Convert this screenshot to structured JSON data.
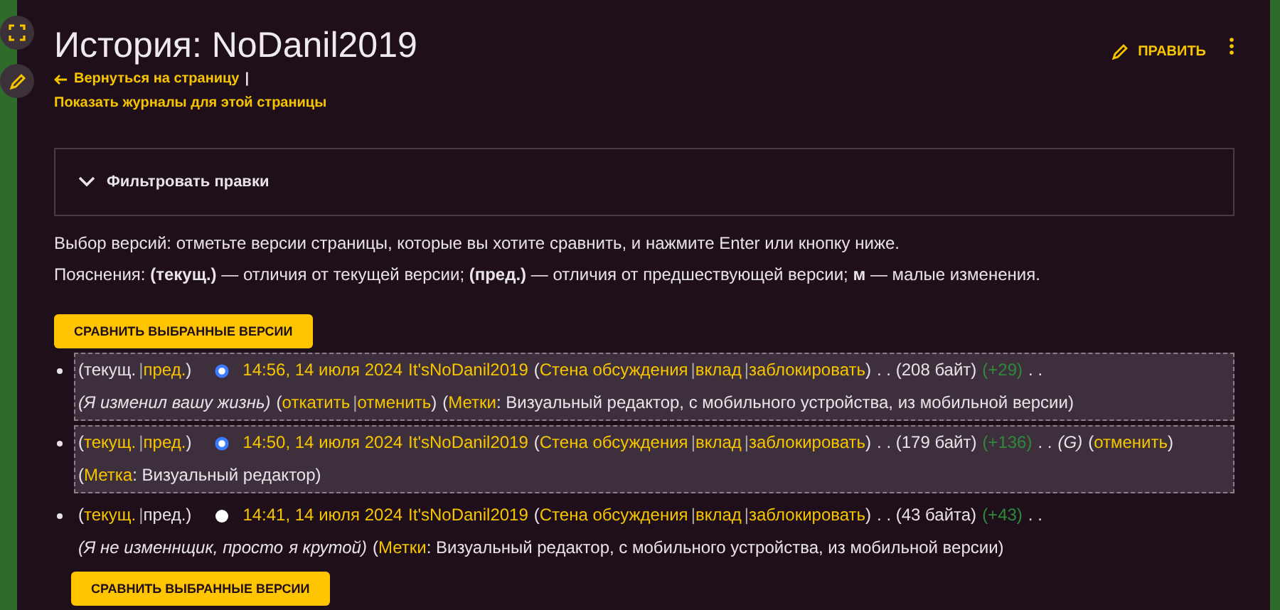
{
  "page": {
    "title": "История: NoDanil2019",
    "back_link": "Вернуться на страницу",
    "back_sep": "|",
    "logs_link": "Показать журналы для этой страницы",
    "edit_button": "ПРАВИТЬ"
  },
  "filter": {
    "label": "Фильтровать правки",
    "expanded": false
  },
  "intro": "Выбор версий: отметьте версии страницы, которые вы хотите сравнить, и нажмите Enter или кнопку ниже.",
  "legend": "Пояснения: **(текущ.)** — отличия от текущей версии; **(пред.)** — отличия от предшествующей версии; **м** — малые изменения.",
  "compare_buttons": [
    "СРАВНИТЬ ВЫБРАННЫЕ ВЕРСИИ",
    "СРАВНИТЬ ВЫБРАННЫЕ ВЕРСИИ"
  ],
  "revisions": [
    {
      "selected": true,
      "segments": [
        {
          "kind": "text",
          "text": "(текущ."
        },
        {
          "kind": "sep",
          "text": "|"
        },
        {
          "kind": "link",
          "text": "пред."
        },
        {
          "kind": "text",
          "text": ")"
        },
        {
          "kind": "radio",
          "checked": true
        },
        {
          "kind": "link",
          "text": "14:56, 14 июля 2024"
        },
        {
          "kind": "link",
          "text": "It'sNoDanil2019"
        },
        {
          "kind": "text",
          "text": "("
        },
        {
          "kind": "link",
          "text": "Стена обсуждения"
        },
        {
          "kind": "sep",
          "text": "|"
        },
        {
          "kind": "link",
          "text": "вклад"
        },
        {
          "kind": "sep",
          "text": "|"
        },
        {
          "kind": "link",
          "text": "заблокировать"
        },
        {
          "kind": "text",
          "text": ")"
        },
        {
          "kind": "text",
          "text": ". . (208 байт)"
        },
        {
          "kind": "diff",
          "text": "(+29)"
        },
        {
          "kind": "text",
          "text": ". ."
        },
        {
          "kind": "comment",
          "text": "(Я изменил вашу жизнь)"
        },
        {
          "kind": "text",
          "text": "("
        },
        {
          "kind": "link",
          "text": "откатить"
        },
        {
          "kind": "sep",
          "text": "|"
        },
        {
          "kind": "link",
          "text": "отменить"
        },
        {
          "kind": "text",
          "text": ")"
        },
        {
          "kind": "text",
          "text": "("
        },
        {
          "kind": "link",
          "text": "Метки"
        },
        {
          "kind": "text",
          "text": ": Визуальный редактор, с мобильного устройства, из мобильной версии)"
        }
      ]
    },
    {
      "selected": true,
      "segments": [
        {
          "kind": "text",
          "text": "("
        },
        {
          "kind": "link",
          "text": "текущ."
        },
        {
          "kind": "sep",
          "text": "|"
        },
        {
          "kind": "link",
          "text": "пред."
        },
        {
          "kind": "text",
          "text": ")"
        },
        {
          "kind": "radio",
          "checked": true
        },
        {
          "kind": "link",
          "text": "14:50, 14 июля 2024"
        },
        {
          "kind": "link",
          "text": "It'sNoDanil2019"
        },
        {
          "kind": "text",
          "text": "("
        },
        {
          "kind": "link",
          "text": "Стена обсуждения"
        },
        {
          "kind": "sep",
          "text": "|"
        },
        {
          "kind": "link",
          "text": "вклад"
        },
        {
          "kind": "sep",
          "text": "|"
        },
        {
          "kind": "link",
          "text": "заблокировать"
        },
        {
          "kind": "text",
          "text": ")"
        },
        {
          "kind": "text",
          "text": ". . (179 байт)"
        },
        {
          "kind": "diff",
          "text": "(+136)"
        },
        {
          "kind": "text",
          "text": ". ."
        },
        {
          "kind": "comment",
          "text": "(G)"
        },
        {
          "kind": "text",
          "text": "("
        },
        {
          "kind": "link",
          "text": "отменить"
        },
        {
          "kind": "text",
          "text": ")"
        },
        {
          "kind": "text",
          "text": "("
        },
        {
          "kind": "link",
          "text": "Метка"
        },
        {
          "kind": "text",
          "text": ": Визуальный редактор)"
        }
      ]
    },
    {
      "selected": false,
      "segments": [
        {
          "kind": "text",
          "text": "("
        },
        {
          "kind": "link",
          "text": "текущ."
        },
        {
          "kind": "sep",
          "text": "|"
        },
        {
          "kind": "text",
          "text": "пред.)"
        },
        {
          "kind": "radio",
          "checked": false
        },
        {
          "kind": "link",
          "text": "14:41, 14 июля 2024"
        },
        {
          "kind": "link",
          "text": "It'sNoDanil2019"
        },
        {
          "kind": "text",
          "text": "("
        },
        {
          "kind": "link",
          "text": "Стена обсуждения"
        },
        {
          "kind": "sep",
          "text": "|"
        },
        {
          "kind": "link",
          "text": "вклад"
        },
        {
          "kind": "sep",
          "text": "|"
        },
        {
          "kind": "link",
          "text": "заблокировать"
        },
        {
          "kind": "text",
          "text": ")"
        },
        {
          "kind": "text",
          "text": ". . (43 байта)"
        },
        {
          "kind": "diff",
          "text": "(+43)"
        },
        {
          "kind": "text",
          "text": ". ."
        },
        {
          "kind": "comment",
          "text": "(Я не изменнщик, просто"
        },
        {
          "kind": "comment",
          "text": "я крутой)"
        },
        {
          "kind": "text",
          "text": "("
        },
        {
          "kind": "link",
          "text": "Метки"
        },
        {
          "kind": "text",
          "text": ": Визуальный редактор, с мобильного устройства, из мобильной версии)"
        }
      ]
    }
  ]
}
